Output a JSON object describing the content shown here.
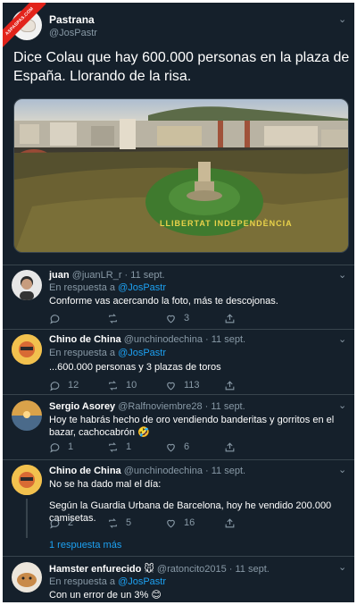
{
  "watermark": "ASPASPAS.COM",
  "main": {
    "name": "Pastrana",
    "handle": "@JosPastr",
    "text": "Dice Colau que hay 600.000 personas en la plaza de España. Llorando de la risa.",
    "photo_caption": "LLIBERTAT INDEPENDÈNCIA"
  },
  "replies": [
    {
      "name": "juan",
      "meta": "@juanLR_r · 11 sept.",
      "reply_prefix": "En respuesta a",
      "reply_to": "@JosPastr",
      "text": "Conforme vas acercando la foto, más te descojonas.",
      "retweets": "",
      "likes": "3",
      "replies_count": ""
    },
    {
      "name": "Chino de China",
      "meta": "@unchinodechina · 11 sept.",
      "reply_prefix": "En respuesta a",
      "reply_to": "@JosPastr",
      "text": "...600.000 personas y 3 plazas de toros",
      "replies_count": "12",
      "retweets": "10",
      "likes": "113"
    },
    {
      "name": "Sergio Asorey",
      "meta": "@Ralfnoviembre28 · 11 sept.",
      "text": "Hoy te habrás hecho de oro vendiendo banderitas y gorritos en el bazar, cachocabrón 🤣",
      "replies_count": "1",
      "retweets": "1",
      "likes": "6"
    },
    {
      "name": "Chino de China",
      "meta": "@unchinodechina · 11 sept.",
      "text_line1": "No se ha dado mal el día:",
      "text_line2": "Según la Guardia Urbana de Barcelona, hoy he vendido 200.000 camisetas.",
      "replies_count": "2",
      "retweets": "5",
      "likes": "16"
    },
    {
      "name": "Hamster enfurecido 🐭",
      "meta": "@ratoncito2015 · 11 sept.",
      "reply_prefix": "En respuesta a",
      "reply_to": "@JosPastr",
      "text": "Con un error de un 3% 😊"
    }
  ],
  "more_replies": "1 respuesta más"
}
